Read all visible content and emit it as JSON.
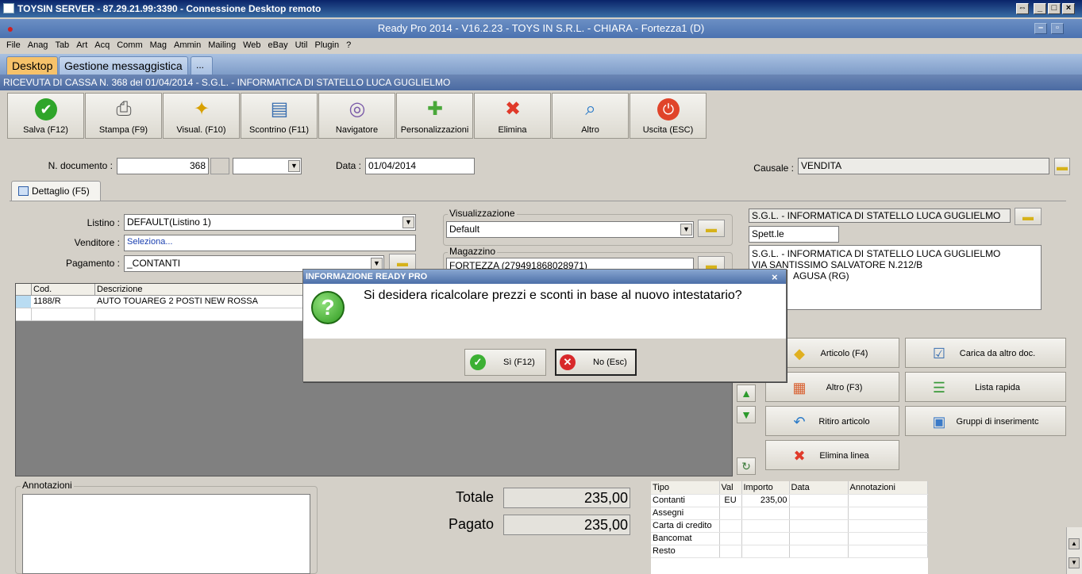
{
  "rdp": {
    "title": "TOYSIN SERVER - 87.29.21.99:3390 - Connessione Desktop remoto",
    "btn_restore": "⇔",
    "btn_min": "_",
    "btn_max": "□",
    "btn_close": "×"
  },
  "app": {
    "title": "Ready Pro 2014 - V16.2.23 - TOYS IN S.R.L. - CHIARA - Fortezza1 (D)",
    "btn_min": "–",
    "btn_max": "▫",
    "btn_close": "×"
  },
  "menu": [
    "File",
    "Anag",
    "Tab",
    "Art",
    "Acq",
    "Comm",
    "Mag",
    "Ammin",
    "Mailing",
    "Web",
    "eBay",
    "Util",
    "Plugin",
    "?"
  ],
  "tabs": {
    "desktop": "Desktop",
    "messaggistica": "Gestione messaggistica",
    "more": "..."
  },
  "document_title": "RICEVUTA DI CASSA N. 368 del 01/04/2014 - S.G.L. - INFORMATICA DI STATELLO LUCA GUGLIELMO",
  "toolbar": [
    {
      "label": "Salva (F12)",
      "icon": "check-icon"
    },
    {
      "label": "Stampa (F9)",
      "icon": "printer-icon"
    },
    {
      "label": "Visual. (F10)",
      "icon": "magic-wand-icon"
    },
    {
      "label": "Scontrino (F11)",
      "icon": "cash-register-icon"
    },
    {
      "label": "Navigatore",
      "icon": "compass-icon"
    },
    {
      "label": "Personalizzazioni",
      "icon": "puzzle-icon"
    },
    {
      "label": "Elimina",
      "icon": "delete-x-icon"
    },
    {
      "label": "Altro",
      "icon": "search-document-icon"
    },
    {
      "label": "Uscita (ESC)",
      "icon": "power-icon"
    }
  ],
  "header": {
    "ndoc_label": "N. documento :",
    "ndoc_value": "368",
    "data_label": "Data :",
    "data_value": "01/04/2014",
    "causale_label": "Causale :",
    "causale_value": "VENDITA"
  },
  "detail_tab": "Dettaglio (F5)",
  "form": {
    "listino_label": "Listino :",
    "listino_value": "DEFAULT(Listino 1)",
    "venditore_label": "Venditore :",
    "venditore_value": "Seleziona...",
    "pagamento_label": "Pagamento :",
    "pagamento_value": "_CONTANTI"
  },
  "visual": {
    "group_label": "Visualizzazione",
    "value": "Default"
  },
  "magazzino": {
    "group_label": "Magazzino",
    "value": "FORTEZZA (279491868028971)"
  },
  "customer": {
    "name": "S.G.L. - INFORMATICA DI STATELLO LUCA GUGLIELMO",
    "salutation": "Spett.le",
    "address_line1": "S.G.L. - INFORMATICA DI STATELLO LUCA GUGLIELMO",
    "address_line2": "VIA SANTISSIMO SALVATORE N.212/B",
    "address_line3": "AGUSA (RG)"
  },
  "grid": {
    "columns": [
      "Cod.",
      "Descrizione"
    ],
    "rows": [
      {
        "cod": "1188/R",
        "descr": "AUTO TOUAREG 2 POSTI NEW ROSSA"
      }
    ]
  },
  "side_buttons": [
    {
      "label": "Articolo (F4)",
      "icon": "cube-add-icon"
    },
    {
      "label": "Carica da altro doc.",
      "icon": "checklist-icon"
    },
    {
      "label": "Altro (F3)",
      "icon": "grid-add-icon"
    },
    {
      "label": "Lista rapida",
      "icon": "list-add-icon"
    },
    {
      "label": "Ritiro articolo",
      "icon": "undo-icon"
    },
    {
      "label": "Gruppi di inserimentc",
      "icon": "box-add-icon"
    },
    {
      "label": "Elimina linea",
      "icon": "delete-x-icon"
    }
  ],
  "annotazioni_label": "Annotazioni",
  "totals": {
    "totale_label": "Totale",
    "totale_value": "235,00",
    "pagato_label": "Pagato",
    "pagato_value": "235,00"
  },
  "payments": {
    "columns": [
      "Tipo",
      "Val",
      "Importo",
      "Data",
      "Annotazioni"
    ],
    "rows": [
      {
        "tipo": "Contanti",
        "val": "EU",
        "importo": "235,00"
      },
      {
        "tipo": "Assegni",
        "val": "",
        "importo": ""
      },
      {
        "tipo": "Carta di credito",
        "val": "",
        "importo": ""
      },
      {
        "tipo": "Bancomat",
        "val": "",
        "importo": ""
      },
      {
        "tipo": "Resto",
        "val": "",
        "importo": ""
      }
    ]
  },
  "dialog": {
    "title": "INFORMAZIONE READY PRO",
    "message": "Si desidera ricalcolare prezzi e sconti in base al nuovo intestatario?",
    "yes": "Sì (F12)",
    "no": "No (Esc)",
    "close": "×",
    "icon": "question-icon"
  }
}
